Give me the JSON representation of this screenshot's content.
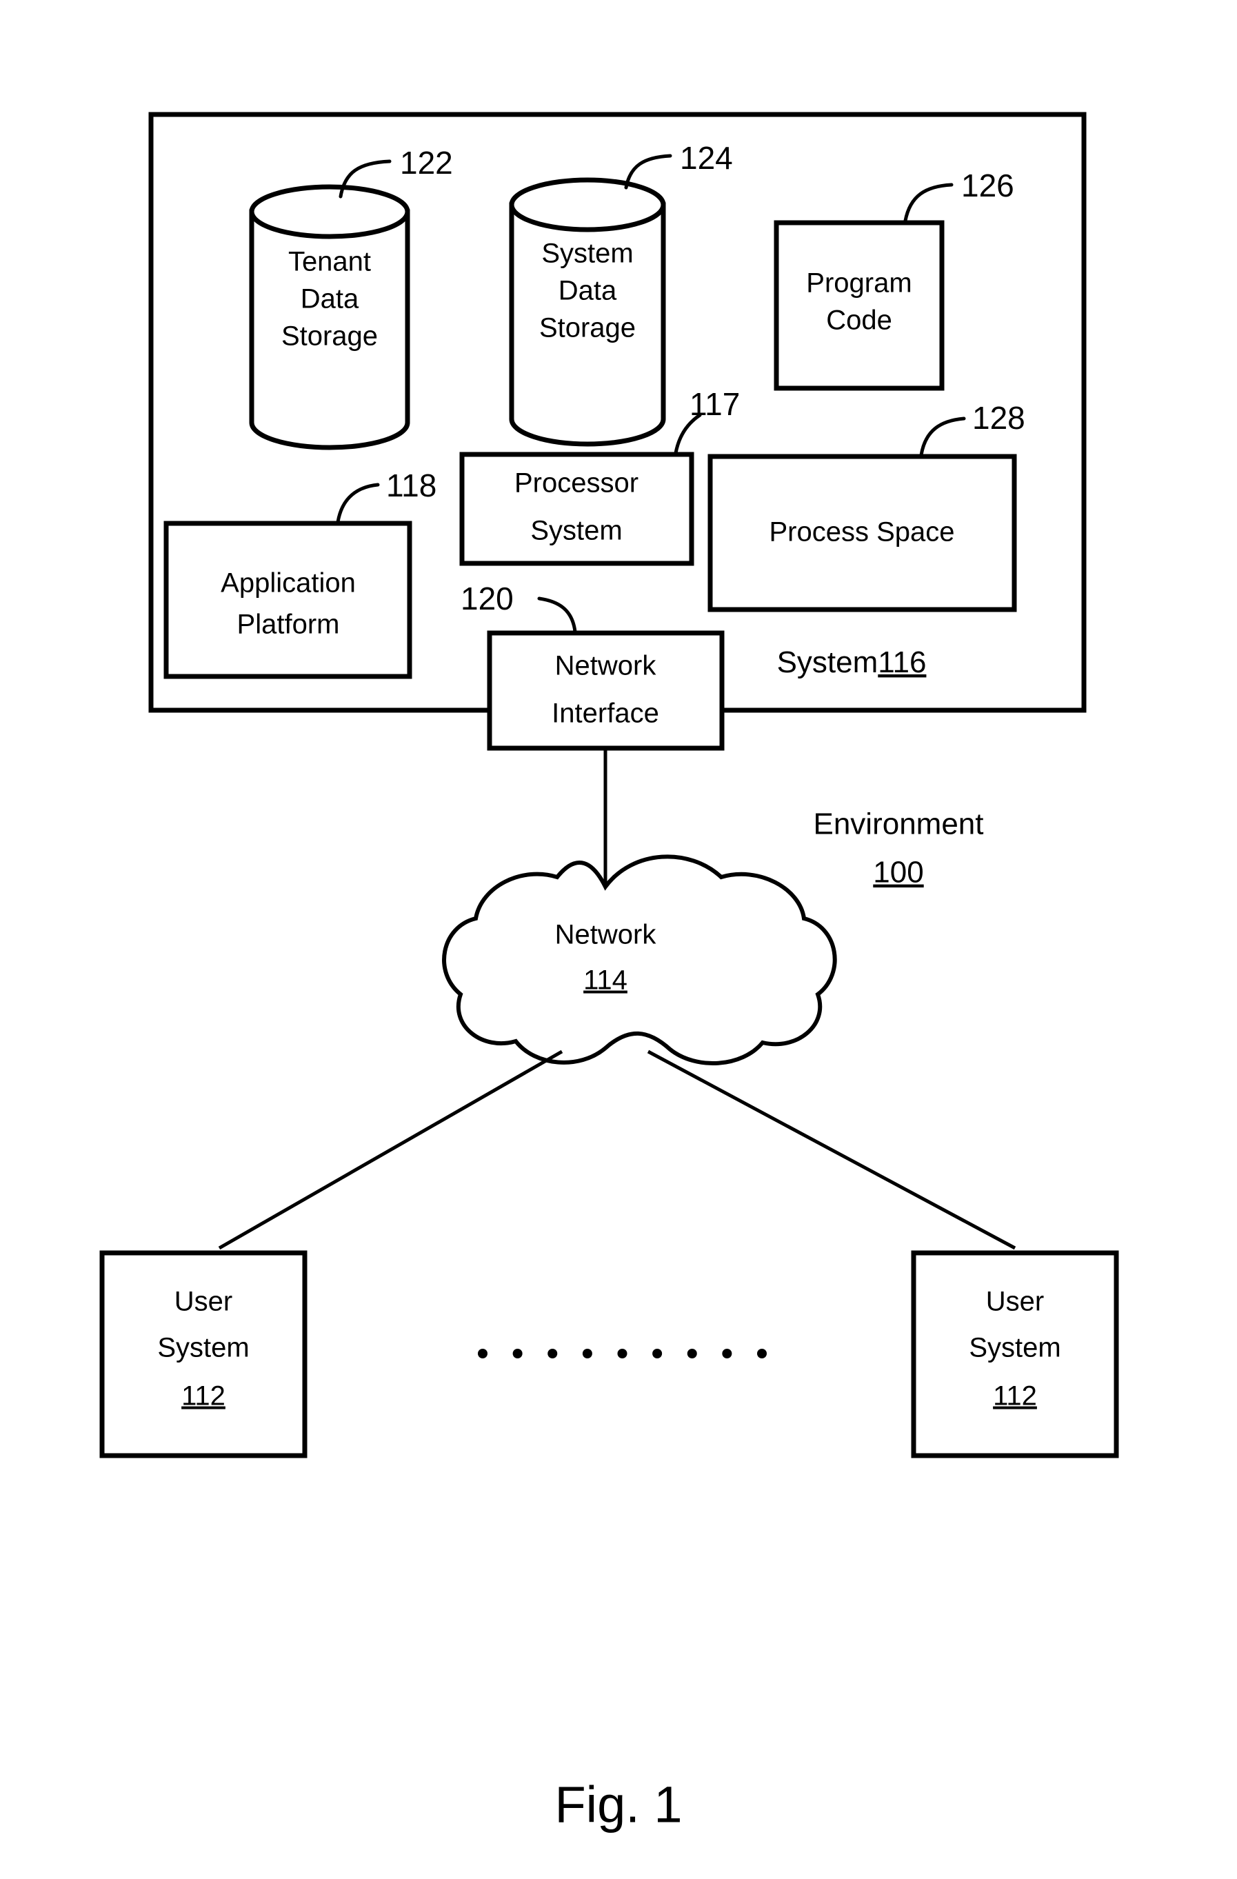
{
  "figure": {
    "caption": "Fig. 1",
    "environment_label": "Environment",
    "environment_ref": "100",
    "system_label": "System",
    "system_ref": "116"
  },
  "blocks": {
    "tenant_data_storage": {
      "line1": "Tenant",
      "line2": "Data",
      "line3": "Storage",
      "ref": "122"
    },
    "system_data_storage": {
      "line1": "System",
      "line2": "Data",
      "line3": "Storage",
      "ref": "124"
    },
    "program_code": {
      "line1": "Program",
      "line2": "Code",
      "ref": "126"
    },
    "processor_system": {
      "line1": "Processor",
      "line2": "System",
      "ref": "117"
    },
    "process_space": {
      "line1": "Process Space",
      "ref": "128"
    },
    "application_platform": {
      "line1": "Application",
      "line2": "Platform",
      "ref": "118"
    },
    "network_interface": {
      "line1": "Network",
      "line2": "Interface",
      "ref": "120"
    },
    "network_cloud": {
      "line1": "Network",
      "ref": "114"
    },
    "user_system_left": {
      "line1": "User",
      "line2": "System",
      "ref": "112"
    },
    "user_system_right": {
      "line1": "User",
      "line2": "System",
      "ref": "112"
    }
  },
  "ellipsis": {
    "dot_count": 9
  }
}
